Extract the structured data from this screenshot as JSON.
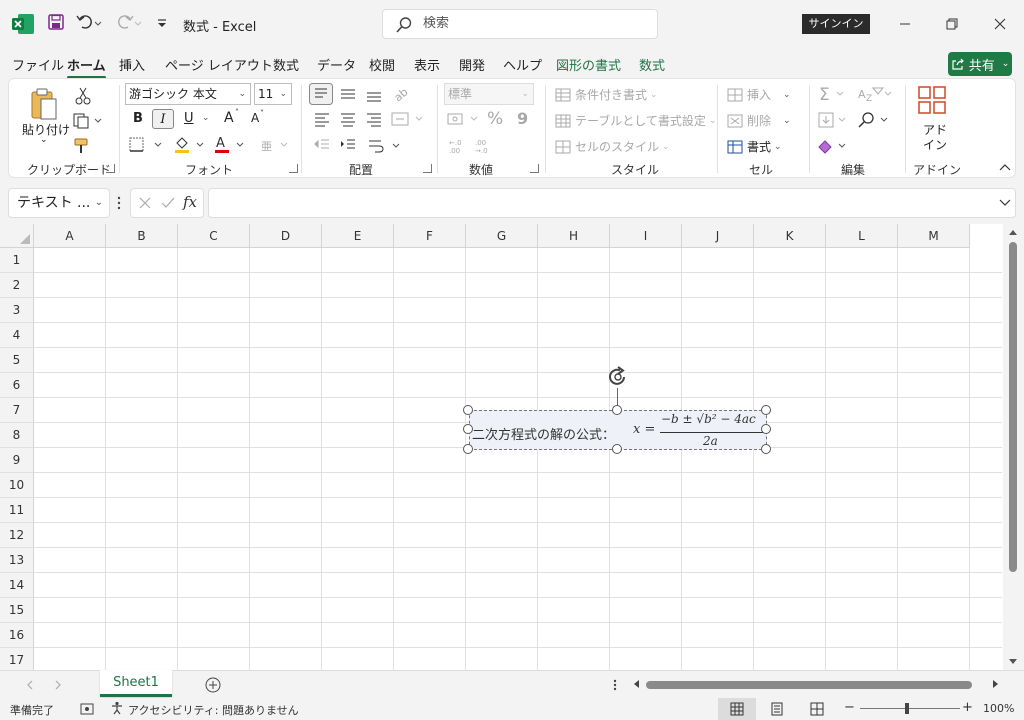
{
  "title_bar": {
    "doc_title": "数式 - Excel",
    "search_placeholder": "検索",
    "signin_label": "サインイン"
  },
  "tabs": [
    {
      "label": "ファイル"
    },
    {
      "label": "ホーム"
    },
    {
      "label": "挿入"
    },
    {
      "label": "ページ レイアウト"
    },
    {
      "label": "数式"
    },
    {
      "label": "データ"
    },
    {
      "label": "校閲"
    },
    {
      "label": "表示"
    },
    {
      "label": "開発"
    },
    {
      "label": "ヘルプ"
    },
    {
      "label": "図形の書式"
    },
    {
      "label": "数式"
    }
  ],
  "share_label": "共有",
  "ribbon": {
    "clipboard": {
      "paste": "貼り付け",
      "label": "クリップボード"
    },
    "font": {
      "font_name": "游ゴシック 本文",
      "font_size": "11",
      "bold": "B",
      "italic": "I",
      "underline": "U",
      "grow": "A",
      "shrink": "A",
      "label": "フォント"
    },
    "alignment": {
      "label": "配置"
    },
    "number": {
      "format": "標準",
      "percent": "%",
      "comma": "9",
      "label": "数値"
    },
    "styles": {
      "conditional": "条件付き書式",
      "table": "テーブルとして書式設定",
      "cell_style": "セルのスタイル",
      "label": "スタイル"
    },
    "cells": {
      "insert": "挿入",
      "delete": "削除",
      "format": "書式",
      "label": "セル"
    },
    "editing": {
      "label": "編集"
    },
    "addins": {
      "button_line1": "アド",
      "button_line2": "イン",
      "label": "アドイン"
    }
  },
  "formula_bar": {
    "name_box": "テキスト ...",
    "fx": "fx",
    "value": ""
  },
  "columns": [
    "A",
    "B",
    "C",
    "D",
    "E",
    "F",
    "G",
    "H",
    "I",
    "J",
    "K",
    "L",
    "M"
  ],
  "rows": [
    "1",
    "2",
    "3",
    "4",
    "5",
    "6",
    "7",
    "8",
    "9",
    "10",
    "11",
    "12",
    "13",
    "14",
    "15",
    "16",
    "17"
  ],
  "equation": {
    "text": "二次方程式の解の公式：",
    "variable": "x =",
    "numerator": "−b ± √b² − 4ac",
    "denominator": "2a"
  },
  "sheets": [
    {
      "name": "Sheet1"
    }
  ],
  "status_bar": {
    "ready": "準備完了",
    "accessibility": "アクセシビリティ: 問題ありません",
    "zoom": "100%",
    "zoom_minus": "−",
    "zoom_plus": "+"
  },
  "colors": {
    "accent": "#217346",
    "share_bg": "#1e7b45"
  }
}
